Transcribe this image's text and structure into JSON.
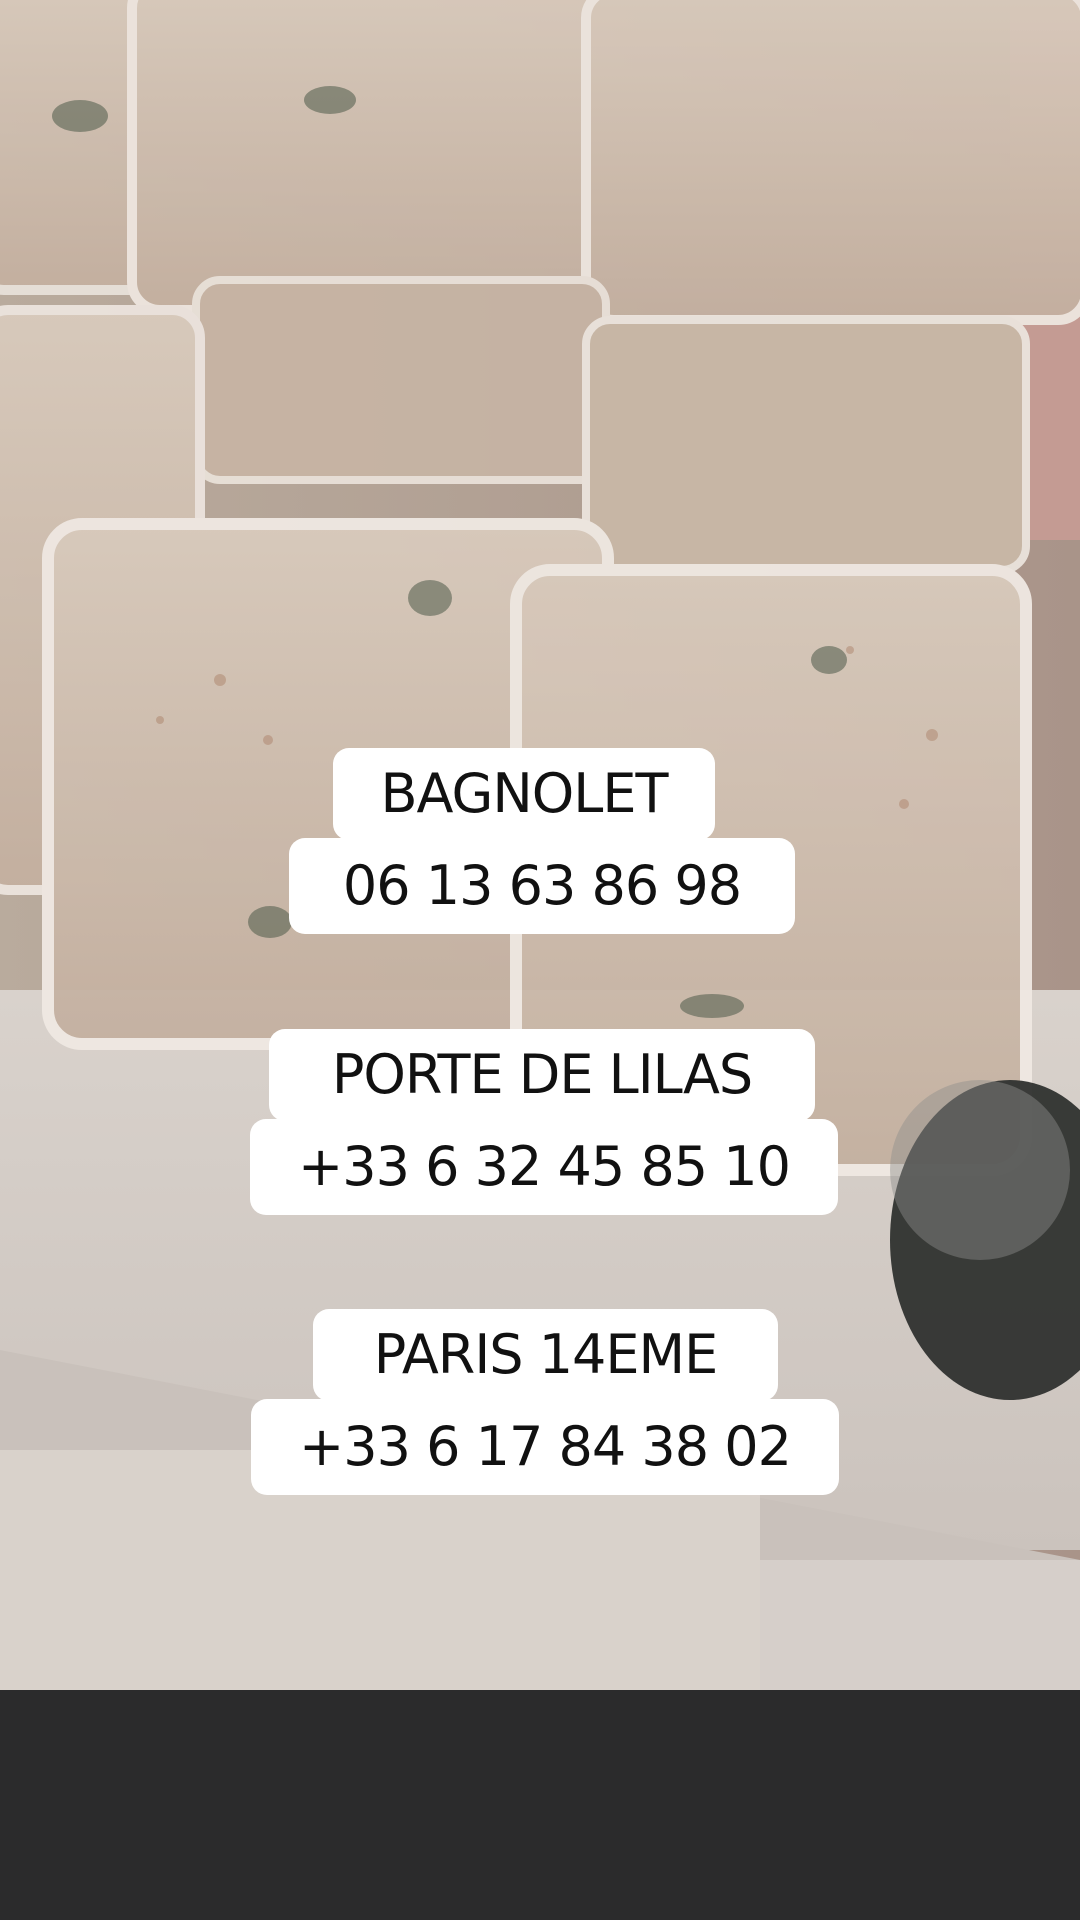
{
  "photo": {
    "subject": "food-containers-photo"
  },
  "captions": [
    {
      "title": "BAGNOLET",
      "phone": "06 13 63 86 98"
    },
    {
      "title": "PORTE DE LILAS",
      "phone": "+33 6 32 45 85 10"
    },
    {
      "title": "PARIS 14EME",
      "phone": "+33 6 17 84 38 02"
    }
  ],
  "colors": {
    "caption_bg": "#ffffff",
    "caption_text": "#111111"
  }
}
